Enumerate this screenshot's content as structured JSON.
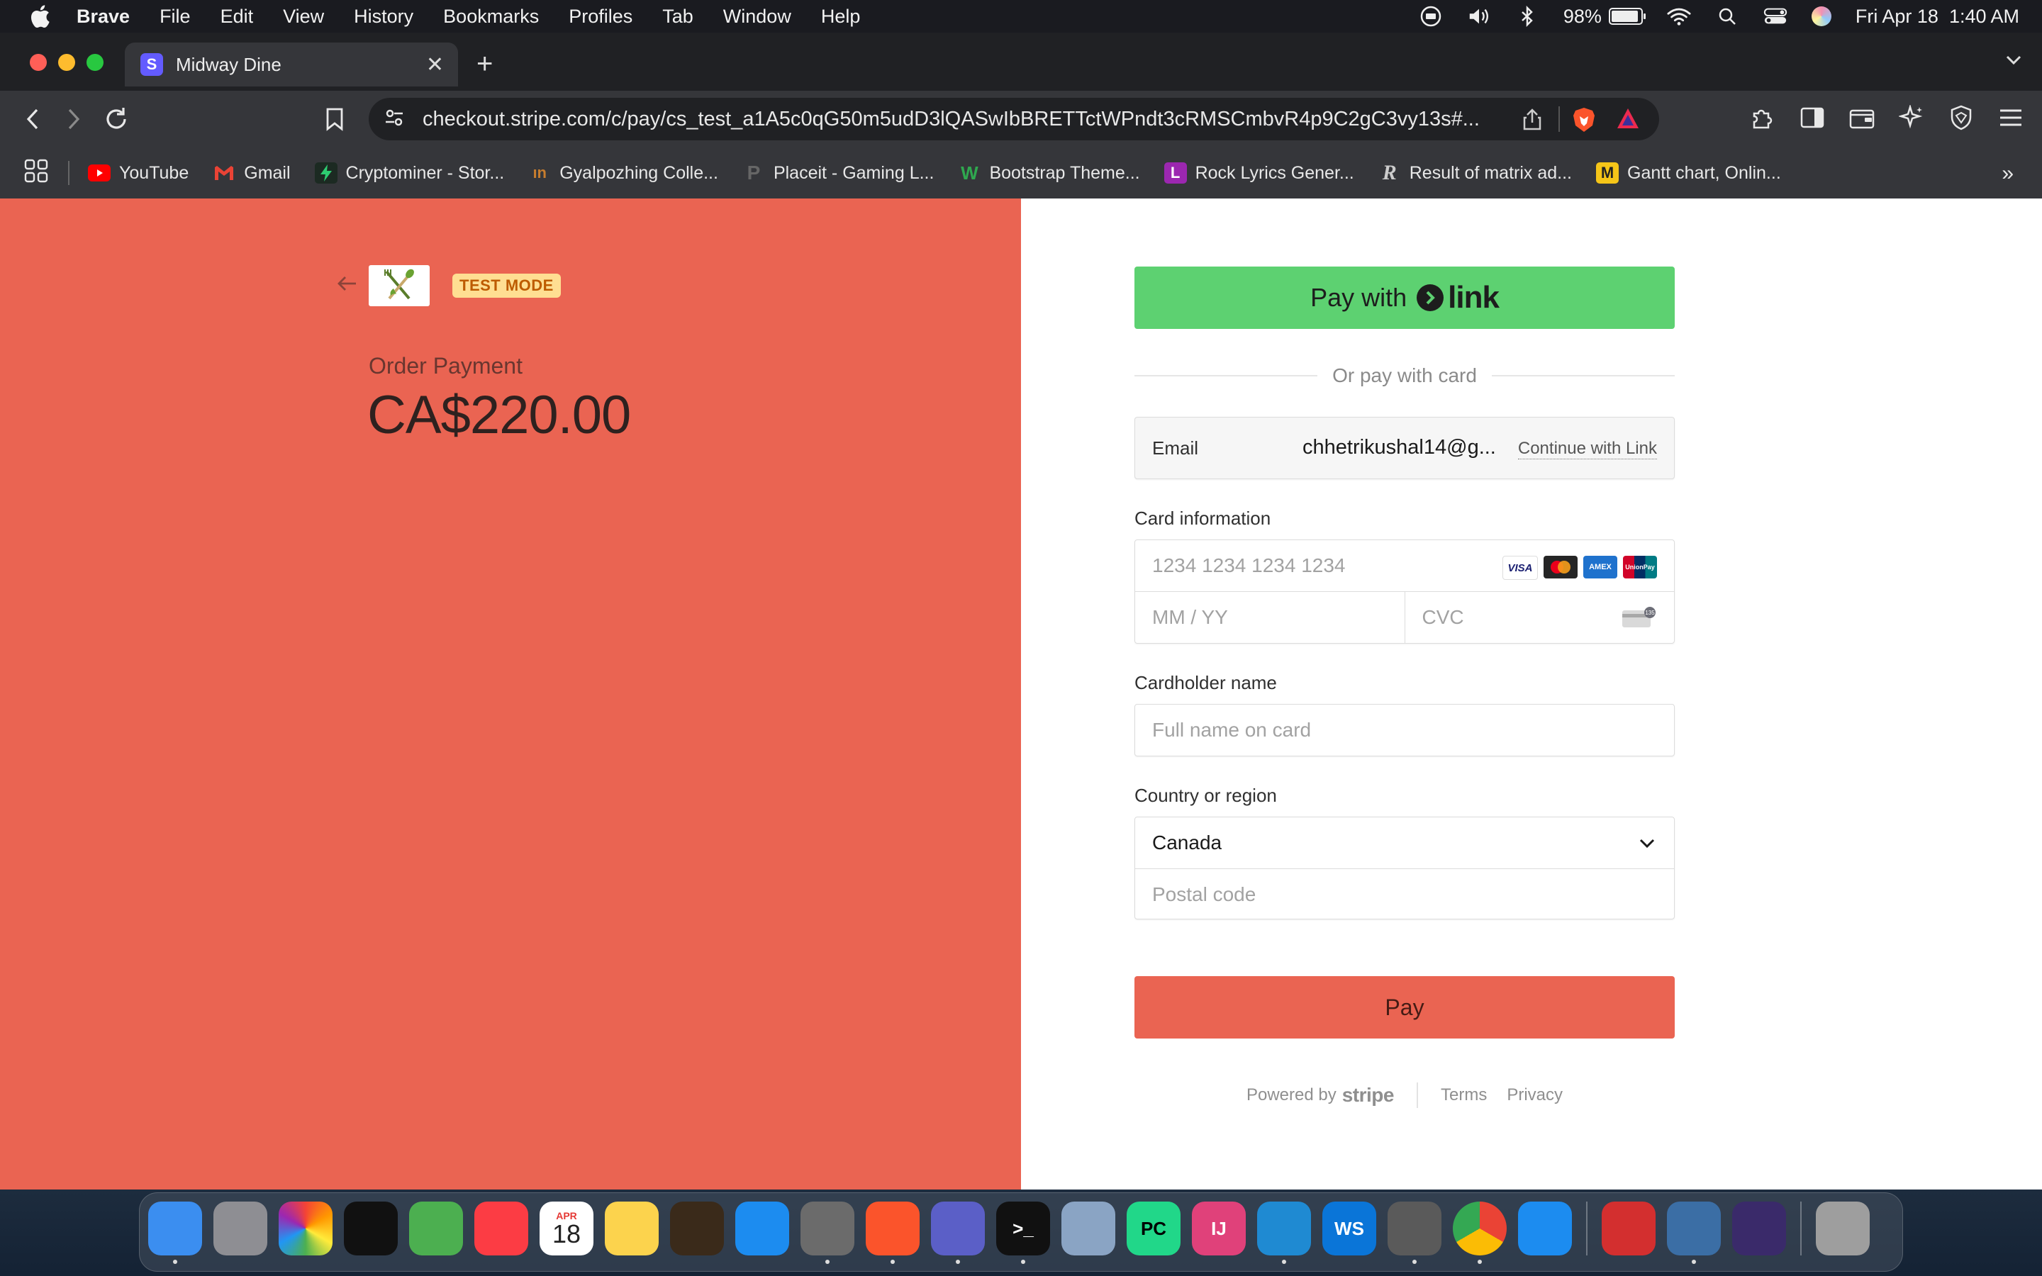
{
  "menubar": {
    "app_name": "Brave",
    "items": [
      "File",
      "Edit",
      "View",
      "History",
      "Bookmarks",
      "Profiles",
      "Tab",
      "Window",
      "Help"
    ],
    "battery_percent": "98%",
    "battery_level": 0.98,
    "datetime": "Fri Apr 18  1:40 AM"
  },
  "browser": {
    "tab_title": "Midway Dine",
    "tab_favicon_letter": "S",
    "url": "checkout.stripe.com/c/pay/cs_test_a1A5c0qG50m5udD3lQASwIbBRETTctWPndt3cRMSCmbvR4p9C2gC3vy13s#...",
    "bookmarks": [
      {
        "label": "YouTube",
        "icon": "youtube-icon",
        "color": "#ff0000"
      },
      {
        "label": "Gmail",
        "icon": "gmail-icon",
        "color": "#ea4335"
      },
      {
        "label": "Cryptominer - Stor...",
        "icon": "lightning-icon",
        "color": "#2ecc71"
      },
      {
        "label": "Gyalpozhing Colle...",
        "icon": "college-icon",
        "color": "#c77d2e"
      },
      {
        "label": "Placeit - Gaming L...",
        "icon": "placeit-icon",
        "color": "#555555"
      },
      {
        "label": "Bootstrap Theme...",
        "icon": "bootstrap-themes-icon",
        "color": "#2fa84f"
      },
      {
        "label": "Rock Lyrics Gener...",
        "icon": "lyrics-icon",
        "color": "#9c27b0"
      },
      {
        "label": "Result of matrix ad...",
        "icon": "r-icon",
        "color": "#cccccc"
      },
      {
        "label": "Gantt chart, Onlin...",
        "icon": "gantt-icon",
        "color": "#f5c518"
      }
    ]
  },
  "checkout": {
    "test_mode_label": "TEST MODE",
    "order_label": "Order Payment",
    "amount": "CA$220.00",
    "pay_with_label": "Pay with",
    "link_brand": "link",
    "or_pay_with_card": "Or pay with card",
    "email_label": "Email",
    "email_value": "chhetrikushal14@g...",
    "continue_with_link": "Continue with Link",
    "card_info_label": "Card information",
    "card_number_placeholder": "1234 1234 1234 1234",
    "expiry_placeholder": "MM / YY",
    "cvc_placeholder": "CVC",
    "card_brands": [
      "VISA",
      "Mastercard",
      "AMEX",
      "UnionPay"
    ],
    "cardholder_label": "Cardholder name",
    "cardholder_placeholder": "Full name on card",
    "country_label": "Country or region",
    "country_value": "Canada",
    "postal_placeholder": "Postal code",
    "pay_button": "Pay",
    "powered_by": "Powered by",
    "stripe_brand": "stripe",
    "terms": "Terms",
    "privacy": "Privacy",
    "brand_color": "#ea6452",
    "link_color": "#5dd171"
  },
  "dock": {
    "apps": [
      {
        "name": "finder-icon",
        "color": "#3b8ef0"
      },
      {
        "name": "launchpad-icon",
        "color": "#8e8e93"
      },
      {
        "name": "photos-icon",
        "color": "#ffffff"
      },
      {
        "name": "apple-tv-icon",
        "color": "#111111"
      },
      {
        "name": "maps-icon",
        "color": "#4caf50"
      },
      {
        "name": "music-icon",
        "color": "#fc3c44"
      },
      {
        "name": "calendar-icon",
        "color": "#ffffff"
      },
      {
        "name": "notes-icon",
        "color": "#fcd34d"
      },
      {
        "name": "garageband-icon",
        "color": "#3a2a1a"
      },
      {
        "name": "app-store-icon",
        "color": "#1c8cf0"
      },
      {
        "name": "system-settings-icon",
        "color": "#6b6b6b"
      },
      {
        "name": "brave-icon",
        "color": "#fb542b"
      },
      {
        "name": "teams-icon",
        "color": "#5b5fc7"
      },
      {
        "name": "terminal-icon",
        "color": "#111111"
      },
      {
        "name": "database-icon",
        "color": "#8aa4c4"
      },
      {
        "name": "pycharm-icon",
        "color": "#21d789"
      },
      {
        "name": "intellij-icon",
        "color": "#e0417a"
      },
      {
        "name": "vscode-icon",
        "color": "#1f8ad2"
      },
      {
        "name": "webstorm-icon",
        "color": "#0a75d8"
      },
      {
        "name": "tableplus-icon",
        "color": "#5a5a5a"
      },
      {
        "name": "chrome-icon",
        "color": "#eeeeee"
      },
      {
        "name": "xcode-instruments-icon",
        "color": "#1c8cf0"
      },
      {
        "name": "acrobat-icon",
        "color": "#d32f2f"
      },
      {
        "name": "mysql-workbench-icon",
        "color": "#3b6ea5"
      },
      {
        "name": "docker-like-icon",
        "color": "#3a2a6a"
      },
      {
        "name": "trash-icon",
        "color": "#9e9e9e"
      }
    ],
    "calendar_month": "APR",
    "calendar_day": "18",
    "terminal_prompt": ">_",
    "pycharm_label": "PC",
    "intellij_label": "IJ",
    "webstorm_label": "WS"
  }
}
